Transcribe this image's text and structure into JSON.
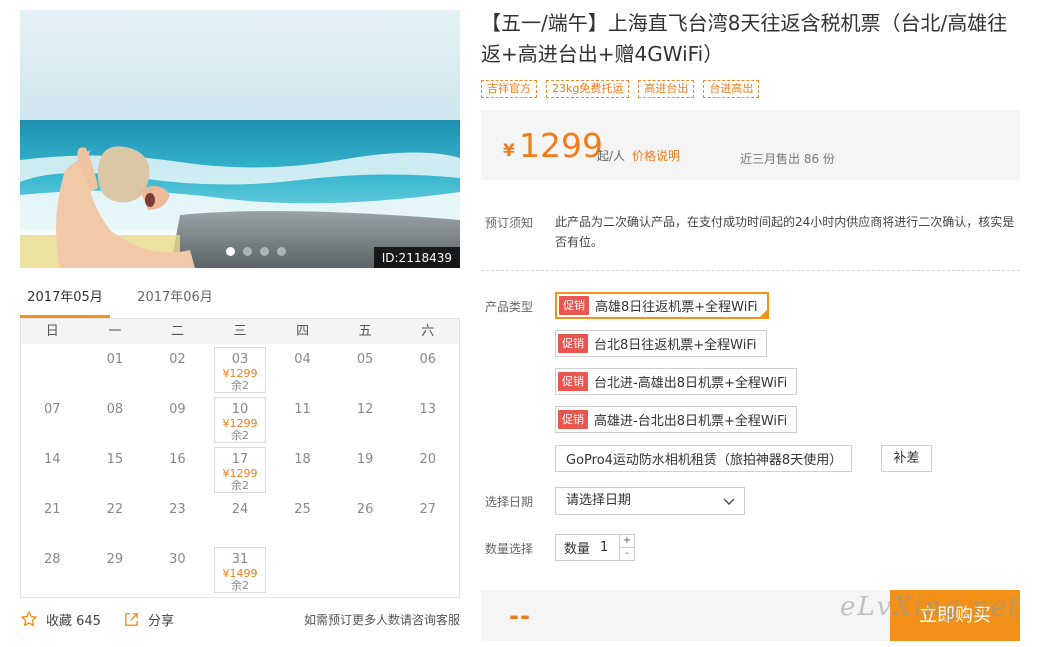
{
  "hero": {
    "id_badge": "ID:2118439",
    "dots": [
      true,
      false,
      false,
      false
    ]
  },
  "calendar": {
    "tabs": [
      "2017年05月",
      "2017年06月"
    ],
    "weekdays": [
      "日",
      "一",
      "二",
      "三",
      "四",
      "五",
      "六"
    ],
    "cells": [
      {
        "day": ""
      },
      {
        "day": "01"
      },
      {
        "day": "02"
      },
      {
        "day": "03",
        "price": "¥1299",
        "left": "余2"
      },
      {
        "day": "04"
      },
      {
        "day": "05"
      },
      {
        "day": "06"
      },
      {
        "day": "07"
      },
      {
        "day": "08"
      },
      {
        "day": "09"
      },
      {
        "day": "10",
        "price": "¥1299",
        "left": "余2"
      },
      {
        "day": "11"
      },
      {
        "day": "12"
      },
      {
        "day": "13"
      },
      {
        "day": "14"
      },
      {
        "day": "15"
      },
      {
        "day": "16"
      },
      {
        "day": "17",
        "price": "¥1299",
        "left": "余2"
      },
      {
        "day": "18"
      },
      {
        "day": "19"
      },
      {
        "day": "20"
      },
      {
        "day": "21"
      },
      {
        "day": "22"
      },
      {
        "day": "23"
      },
      {
        "day": "24"
      },
      {
        "day": "25"
      },
      {
        "day": "26"
      },
      {
        "day": "27"
      },
      {
        "day": "28"
      },
      {
        "day": "29"
      },
      {
        "day": "30"
      },
      {
        "day": "31",
        "price": "¥1499",
        "left": "余2"
      },
      {
        "day": ""
      },
      {
        "day": ""
      },
      {
        "day": ""
      }
    ]
  },
  "social": {
    "favorite_label": "收藏 645",
    "share_label": "分享",
    "note": "如需预订更多人数请咨询客服"
  },
  "product": {
    "title": "【五一/端午】上海直飞台湾8天往返含税机票（台北/高雄往返+高进台出+赠4GWiFi）",
    "tags": [
      "吉祥官方",
      "23kg免费托运",
      "高进台出",
      "台进高出"
    ]
  },
  "price": {
    "currency": "¥",
    "amount": "1299",
    "per": "起/人",
    "note_link": "价格说明",
    "sold": "近三月售出 86 份"
  },
  "notice": {
    "label": "预订须知",
    "text": "此产品为二次确认产品，在支付成功时间起的24小时内供应商将进行二次确认，核实是否有位。"
  },
  "product_type": {
    "label": "产品类型",
    "promo_badge": "促销",
    "options": [
      {
        "label": "高雄8日往返机票+全程WiFi",
        "promo": true,
        "selected": true
      },
      {
        "label": "台北8日往返机票+全程WiFi",
        "promo": true,
        "selected": false
      },
      {
        "label": "台北进-高雄出8日机票+全程WiFi",
        "promo": true,
        "selected": false
      },
      {
        "label": "高雄进-台北出8日机票+全程WiFi",
        "promo": true,
        "selected": false
      },
      {
        "label": "GoPro4运动防水相机租赁（旅拍神器8天使用）",
        "promo": false,
        "selected": false
      }
    ],
    "extra_button": "补差"
  },
  "date": {
    "label": "选择日期",
    "placeholder": "请选择日期"
  },
  "quantity": {
    "label": "数量选择",
    "prefix": "数量",
    "value": "1",
    "plus": "+",
    "minus": "-"
  },
  "buy": {
    "total": "--",
    "button": "立即购买",
    "watermark": "eLvXing.net"
  },
  "colors": {
    "accent": "#f29018",
    "price": "#f07d1a",
    "promo": "#e8564f"
  }
}
